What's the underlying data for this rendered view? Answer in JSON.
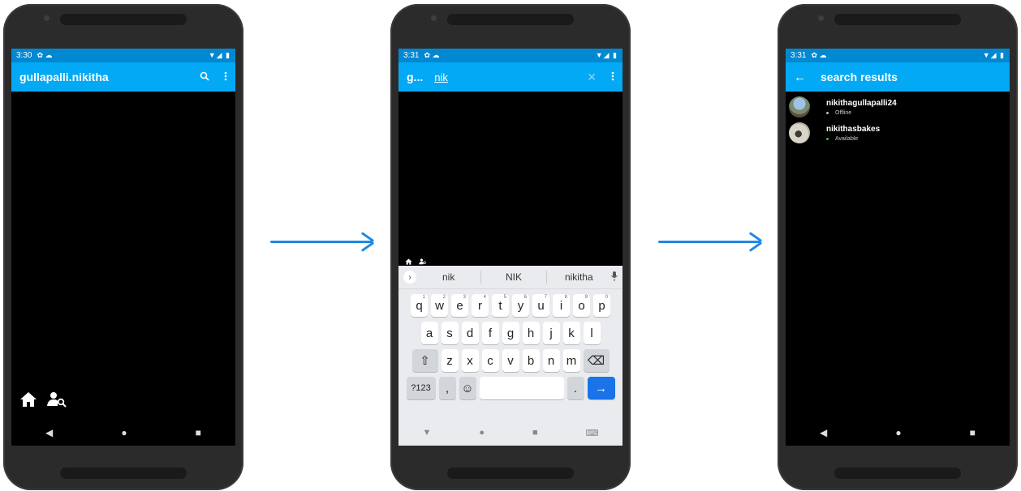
{
  "colors": {
    "statusbar": "#0288d1",
    "appbar": "#03a9f4",
    "accent": "#1a73e8",
    "arrow": "#1e88e5",
    "offline": "#bdbdbd",
    "available": "#4caf50"
  },
  "phone1": {
    "status_time": "3:30",
    "status_left_icons": "✿ ☁",
    "status_right_icons": "▼◢ ▮",
    "title": "gullapalli.nikitha",
    "search_icon": "search-icon",
    "menu_icon": "overflow-menu-icon",
    "bottom_icons": [
      "home-icon",
      "person-search-icon"
    ],
    "nav": [
      "◀",
      "●",
      "■"
    ]
  },
  "phone2": {
    "status_time": "3:31",
    "status_left_icons": "✿ ☁",
    "status_right_icons": "▼◢ ▮",
    "title": "g...",
    "search_value": "nik",
    "clear_icon": "✕",
    "suggestions": [
      "nik",
      "NIK",
      "nikitha"
    ],
    "row1": [
      {
        "k": "q",
        "s": "1"
      },
      {
        "k": "w",
        "s": "2"
      },
      {
        "k": "e",
        "s": "3"
      },
      {
        "k": "r",
        "s": "4"
      },
      {
        "k": "t",
        "s": "5"
      },
      {
        "k": "y",
        "s": "6"
      },
      {
        "k": "u",
        "s": "7"
      },
      {
        "k": "i",
        "s": "8"
      },
      {
        "k": "o",
        "s": "9"
      },
      {
        "k": "p",
        "s": "0"
      }
    ],
    "row2": [
      "a",
      "s",
      "d",
      "f",
      "g",
      "h",
      "j",
      "k",
      "l"
    ],
    "row3": [
      "z",
      "x",
      "c",
      "v",
      "b",
      "n",
      "m"
    ],
    "symbols_key": "?123",
    "comma_key": ",",
    "period_key": ".",
    "emoji_key": "☺",
    "enter_key": "→",
    "shift_key": "⇧",
    "backspace_key": "⌫",
    "kbnav": [
      "▼",
      "●",
      "■",
      "⌨"
    ]
  },
  "phone3": {
    "status_time": "3:31",
    "status_left_icons": "✿ ☁",
    "status_right_icons": "▼◢ ▮",
    "back_icon": "←",
    "title": "search results",
    "results": [
      {
        "name": "nikithagullapalli24",
        "status": "Offline"
      },
      {
        "name": "nikithasbakes",
        "status": "Available"
      }
    ],
    "nav": [
      "◀",
      "●",
      "■"
    ]
  }
}
